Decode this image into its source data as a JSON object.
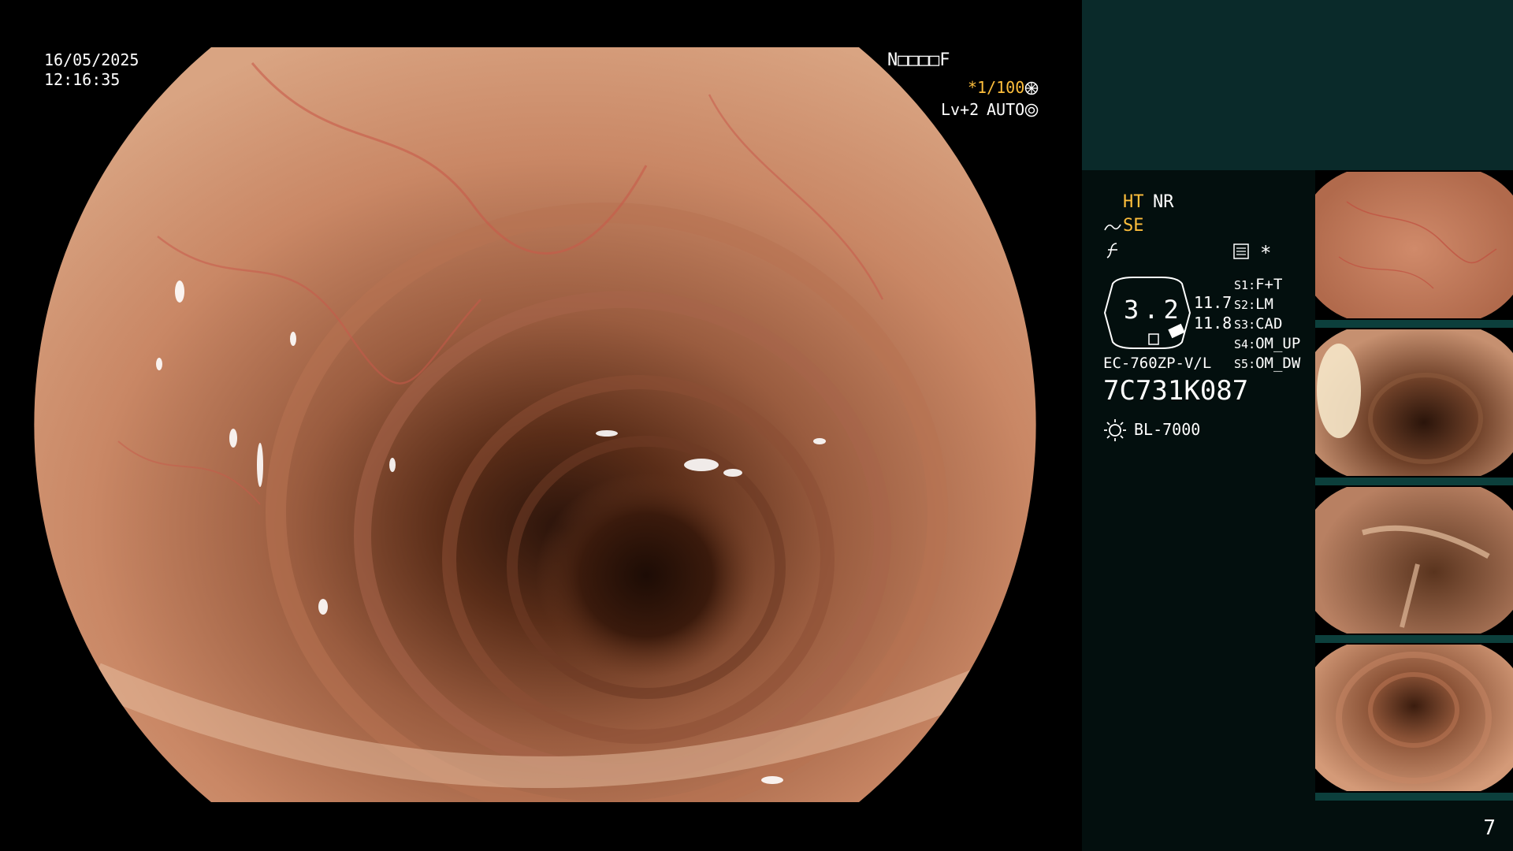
{
  "overlay": {
    "date": "16/05/2025",
    "time": "12:16:35",
    "patient_id": "N□□□□F",
    "shutter": "*1/100",
    "shutter_icon": "aperture-icon",
    "level": "Lv+2",
    "iris_mode": "AUTO",
    "iris_icon": "iris-icon"
  },
  "panel": {
    "ht_label": "HT",
    "nr_label": "NR",
    "se_label": "SE",
    "se_icon": "curve-enhance-icon",
    "f_icon": "frequency-icon",
    "record_icon": "record-icon",
    "asterisk": "*",
    "zoom_value": "3.2",
    "zoom_values": [
      "11.7",
      "11.8"
    ],
    "presets": [
      {
        "key": "S1",
        "value": "F+T"
      },
      {
        "key": "S2",
        "value": "LM"
      },
      {
        "key": "S3",
        "value": "CAD"
      },
      {
        "key": "S4",
        "value": "OM_UP"
      },
      {
        "key": "S5",
        "value": "OM_DW"
      }
    ],
    "scope_model": "EC-760ZP-V/L",
    "scope_serial": "7C731K087",
    "light_icon": "light-source-icon",
    "light_source": "BL-7000",
    "frame_count": "7"
  },
  "thumbnails": [
    {
      "name": "capture-1"
    },
    {
      "name": "capture-2"
    },
    {
      "name": "capture-3"
    },
    {
      "name": "capture-4"
    }
  ],
  "colors": {
    "panel_bg": "#030f0e",
    "panel_header": "#0a2a2a",
    "accent_yellow": "#ffbf3c",
    "thumb_bar": "#0c3f3c"
  }
}
